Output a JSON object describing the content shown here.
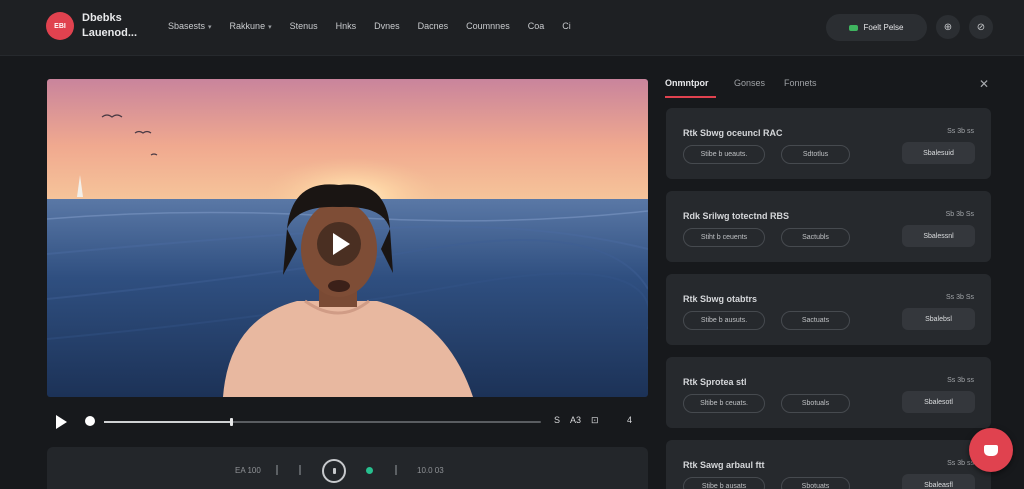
{
  "header": {
    "logo_badge": "EBI",
    "logo_line1": "Dbebks",
    "logo_line2": "Lauenod...",
    "nav": [
      {
        "label": "Sbasests",
        "caret": true
      },
      {
        "label": "Rakkune",
        "caret": true
      },
      {
        "label": "Stenus",
        "caret": false
      },
      {
        "label": "Hnks",
        "caret": false
      },
      {
        "label": "Dvnes",
        "caret": false
      },
      {
        "label": "Dacnes",
        "caret": false
      },
      {
        "label": "Coumnnes",
        "caret": false
      },
      {
        "label": "Coa",
        "caret": false
      },
      {
        "label": "Ci",
        "caret": false
      }
    ],
    "promo_label": "Foelt Pelse",
    "promo_color": "#3fb45f",
    "icon_a": "info-icon",
    "icon_b": "user-icon"
  },
  "player": {
    "progress": 0.29,
    "controls_right": [
      "S",
      "A3",
      "⊡",
      "4"
    ],
    "bottom_left": "EA 100",
    "bottom_right": "10.0 03"
  },
  "panel": {
    "tabs": [
      {
        "label": "Onmntpor",
        "active": true
      },
      {
        "label": "Gonses",
        "active": false
      },
      {
        "label": "Fonnets",
        "active": false
      }
    ],
    "close_icon": "close-icon",
    "cards": [
      {
        "title": "Rtk Sbwg oceuncl RAC",
        "meta": "Ss 3b ss",
        "chip1": "Stibe b ueauts.",
        "chip2": "Sdtotlus",
        "button": "Sbalesuid"
      },
      {
        "title": "Rdk Srilwg totectnd RBS",
        "meta": "Sb 3b Ss",
        "chip1": "Stiht b ceuents",
        "chip2": "Sactubls",
        "button": "Sbalessnl"
      },
      {
        "title": "Rtk Sbwg otabtrs",
        "meta": "Ss 3b Ss",
        "chip1": "Stibe b ausuts.",
        "chip2": "Sactuats",
        "button": "Sbalebsl"
      },
      {
        "title": "Rtk Sprotea stl",
        "meta": "Ss 3b ss",
        "chip1": "Sltibe b ceuats.",
        "chip2": "Sbotuals",
        "button": "Sbalesotl"
      },
      {
        "title": "Rtk Sawg arbaul ftt",
        "meta": "Ss 3b ss",
        "chip1": "Stibe b ausats",
        "chip2": "Sbotuats",
        "button": "Sbaleasfl"
      }
    ]
  },
  "accent_color": "#e0424f",
  "fab_icon": "chat-icon"
}
